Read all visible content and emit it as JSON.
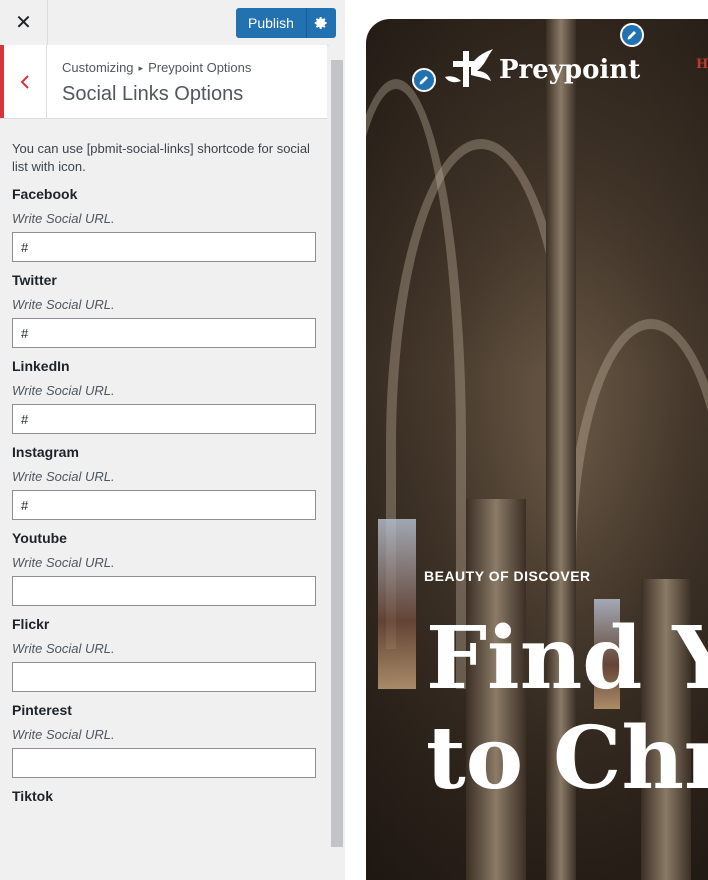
{
  "topbar": {
    "close_label": "✕",
    "publish_label": "Publish"
  },
  "section": {
    "breadcrumb_root": "Customizing",
    "breadcrumb_separator": "▸",
    "breadcrumb_parent": "Preypoint Options",
    "title": "Social Links Options"
  },
  "description": "You can use [pbmit-social-links] shortcode for social list with icon.",
  "fields": [
    {
      "label": "Facebook",
      "desc": "Write Social URL.",
      "value": "#"
    },
    {
      "label": "Twitter",
      "desc": "Write Social URL.",
      "value": "#"
    },
    {
      "label": "LinkedIn",
      "desc": "Write Social URL.",
      "value": "#"
    },
    {
      "label": "Instagram",
      "desc": "Write Social URL.",
      "value": "#"
    },
    {
      "label": "Youtube",
      "desc": "Write Social URL.",
      "value": ""
    },
    {
      "label": "Flickr",
      "desc": "Write Social URL.",
      "value": ""
    },
    {
      "label": "Pinterest",
      "desc": "Write Social URL.",
      "value": ""
    },
    {
      "label": "Tiktok",
      "desc": "",
      "value": ""
    }
  ],
  "preview": {
    "site_name": "Preypoint",
    "nav_home": "HOM",
    "hero_kicker": "BEAUTY OF DISCOVER",
    "hero_line1": "Find Y",
    "hero_line2": "to Chr"
  },
  "colors": {
    "accent": "#2271b1",
    "back_border": "#d63638",
    "nav_active": "#c0392b"
  },
  "icons": {
    "close": "close-icon",
    "settings": "gear-icon",
    "back": "chevron-left-icon",
    "edit": "pencil-icon",
    "logo": "dove-cross-logo"
  }
}
